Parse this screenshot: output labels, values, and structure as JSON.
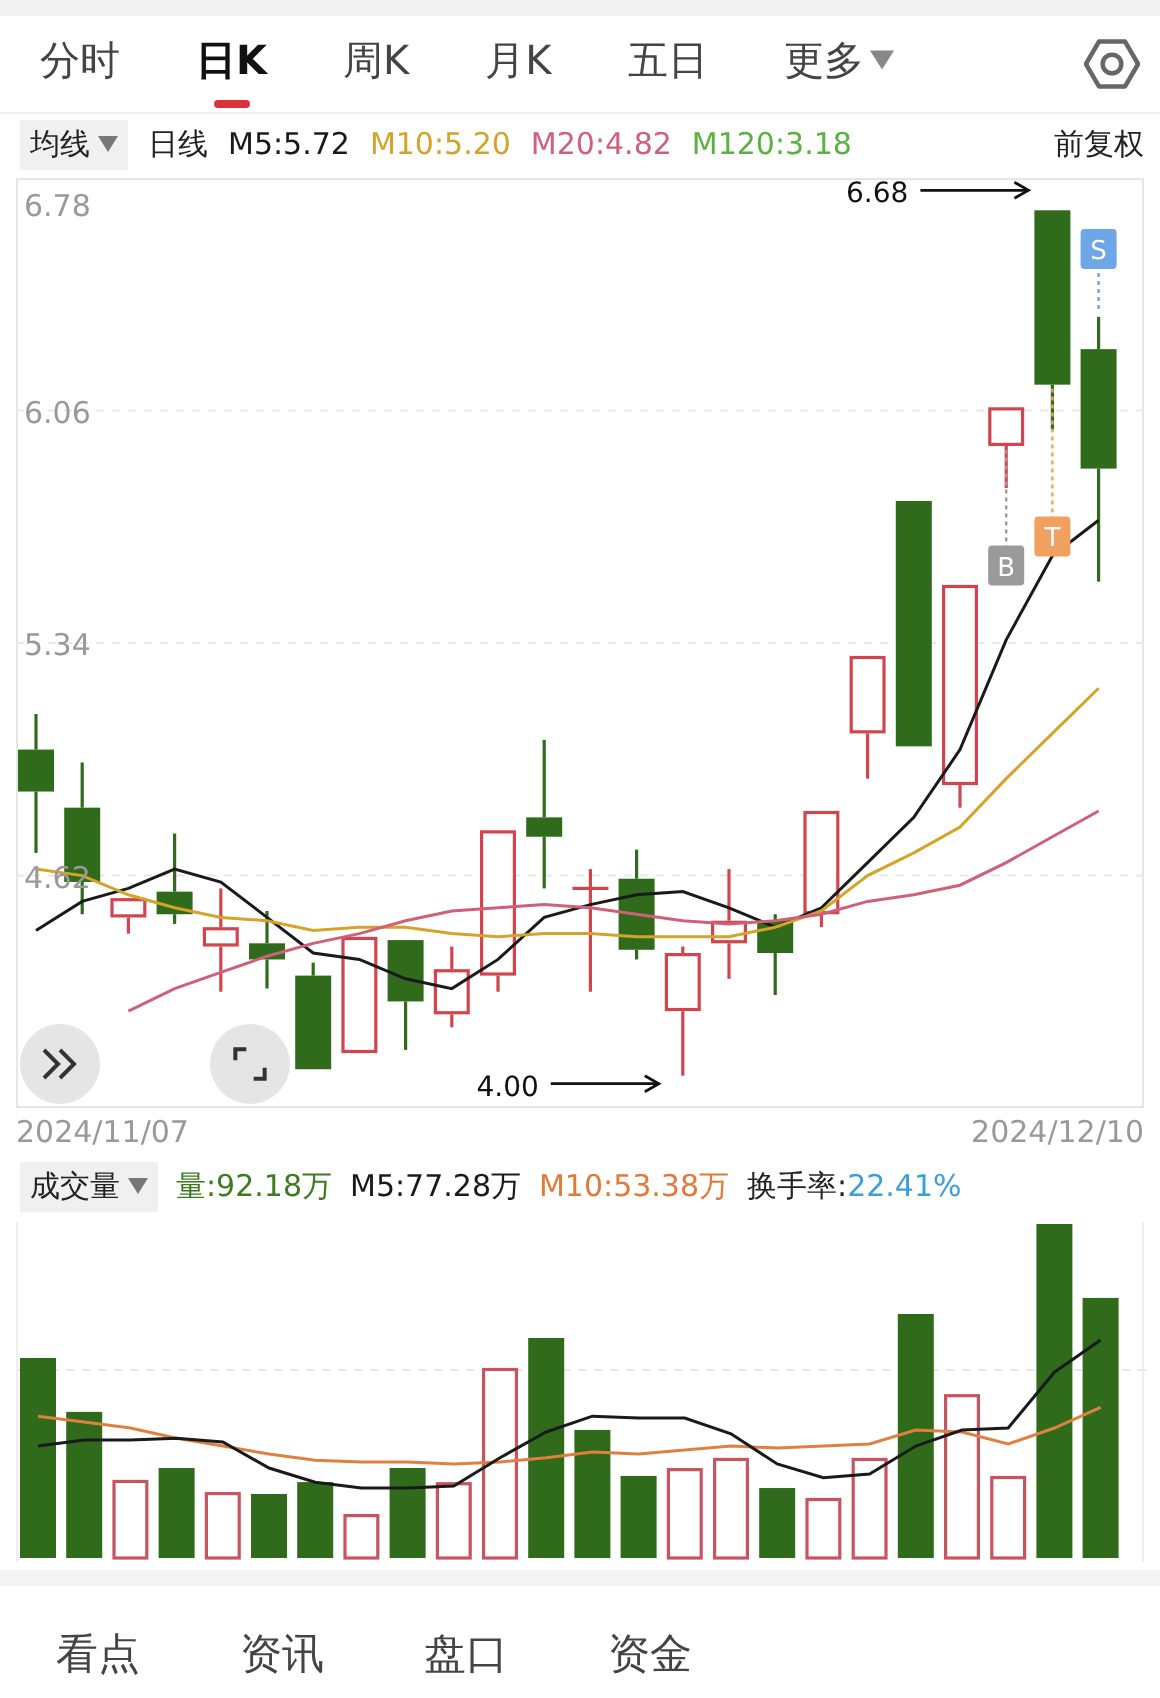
{
  "tabs": [
    {
      "label": "分时",
      "selected": false
    },
    {
      "label": "日K",
      "selected": true
    },
    {
      "label": "周K",
      "selected": false
    },
    {
      "label": "月K",
      "selected": false
    },
    {
      "label": "五日",
      "selected": false
    },
    {
      "label": "更多",
      "selected": false,
      "kind": "dropdown"
    }
  ],
  "indicator_bar": {
    "selector": "均线",
    "period": "日线",
    "extra_average": {
      "label": "M120:3.18",
      "color": "#5cb040"
    },
    "adjustment": "前复权"
  },
  "price_chart": {
    "chart_data": {
      "type": "line",
      "ylim": [
        3.9,
        6.78
      ],
      "yticks": [
        6.78,
        6.06,
        5.34,
        4.62
      ],
      "grid": true,
      "series": [
        {
          "name": "M5:5.72",
          "color": "#1a1a1a",
          "values": [
            4.45,
            4.54,
            4.58,
            4.64,
            4.6,
            4.49,
            4.38,
            4.36,
            4.3,
            4.27,
            4.36,
            4.49,
            4.53,
            4.56,
            4.57,
            4.52,
            4.46,
            4.52,
            4.66,
            4.8,
            5.01,
            5.35,
            5.61,
            5.72
          ]
        },
        {
          "name": "M10:5.20",
          "color": "#d4a42a",
          "values": [
            4.64,
            4.62,
            4.56,
            4.52,
            4.49,
            4.48,
            4.45,
            4.46,
            4.46,
            4.44,
            4.43,
            4.44,
            4.44,
            4.43,
            4.43,
            4.43,
            4.46,
            4.51,
            4.62,
            4.69,
            4.77,
            4.92,
            5.06,
            5.2
          ]
        },
        {
          "name": "M20:4.82",
          "color": "#d0607a",
          "values": [
            null,
            null,
            4.2,
            4.27,
            4.32,
            4.37,
            4.41,
            4.44,
            4.48,
            4.51,
            4.52,
            4.53,
            4.52,
            4.5,
            4.48,
            4.47,
            4.48,
            4.5,
            4.54,
            4.56,
            4.59,
            4.66,
            4.74,
            4.82
          ]
        }
      ],
      "annotations": [
        {
          "text": "6.68"
        },
        {
          "text": "4.00"
        }
      ]
    },
    "trade_markers": [
      {
        "text": "B",
        "color": "#9a9a9a"
      },
      {
        "text": "T",
        "color": "#f2a060"
      },
      {
        "text": "S",
        "color": "#6ea6e8"
      }
    ],
    "start_date": "2024/11/07",
    "end_date": "2024/12/10"
  },
  "volume_bar": {
    "selector": "成交量",
    "readings": [
      {
        "text": "量:92.18万",
        "color": "#3d7a22"
      },
      {
        "text": "M5:77.28万",
        "color": "#1a1a1a"
      },
      {
        "text": "M10:53.38万",
        "color": "#e07a3a"
      }
    ],
    "turnover_label": "换手率:",
    "turnover_value": "22.41%"
  },
  "bottom_tabs": [
    {
      "label": "看点"
    },
    {
      "label": "资讯"
    },
    {
      "label": "盘口"
    },
    {
      "label": "资金"
    }
  ]
}
